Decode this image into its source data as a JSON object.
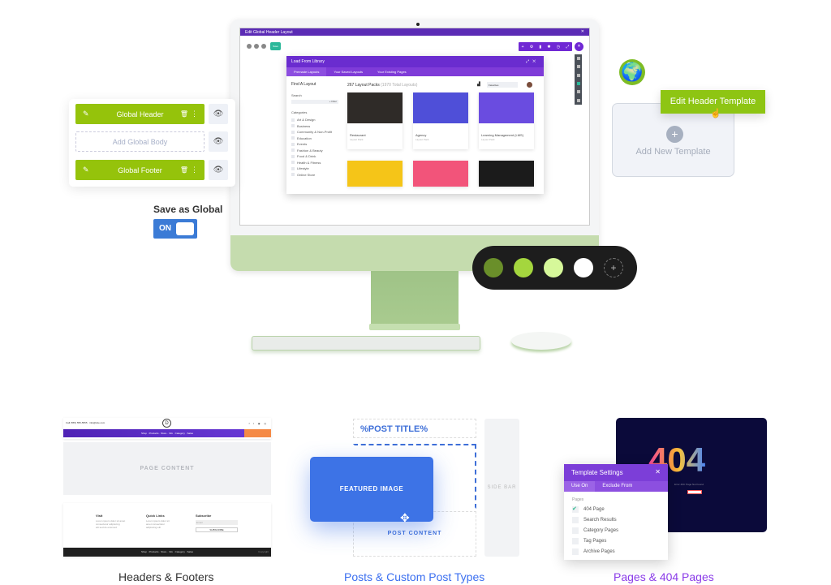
{
  "editor": {
    "window_title": "Edit Global Header Layout",
    "save_label": "Save",
    "library": {
      "title": "Load From Library",
      "tabs": [
        "Premade Layouts",
        "Your Saved Layouts",
        "Your Existing Pages"
      ],
      "find_label": "Find A Layout",
      "search_label": "Search",
      "filter_label": "+ Filter",
      "categories_label": "Categories",
      "categories": [
        "Art & Design",
        "Business",
        "Community & Non-Profit",
        "Education",
        "Events",
        "Fashion & Beauty",
        "Food & Drink",
        "Health & Fitness",
        "Lifestyle",
        "Online Store"
      ],
      "packs_count": "267 Layout Packs",
      "total_layouts": "(1970 Total Layouts)",
      "sort_value": "Favorites",
      "cards": [
        {
          "name": "Restaurant",
          "sub": "Layout Pack",
          "color": "#2f2b28"
        },
        {
          "name": "Agency",
          "sub": "Layout Pack",
          "color": "#4f4fd8"
        },
        {
          "name": "Learning Management (LMS)",
          "sub": "Layout Pack",
          "color": "#6a4ce0"
        }
      ],
      "row2_colors": [
        "#f5c518",
        "#f2547a",
        "#1b1b1b"
      ]
    }
  },
  "global_panel": {
    "header_label": "Global Header",
    "body_label": "Add Global Body",
    "footer_label": "Global Footer",
    "save_as_global_label": "Save as Global",
    "toggle_label": "ON",
    "toggle_state": "on"
  },
  "templates": {
    "edit_header_label": "Edit Header Template",
    "add_new_label": "Add New Template"
  },
  "palette": {
    "swatches": [
      "#6a8f2a",
      "#a4d63e",
      "#d6f89a",
      "#ffffff"
    ],
    "add_label": "+"
  },
  "features": {
    "headers_footers": {
      "caption": "Headers & Footers",
      "page_content_label": "PAGE CONTENT",
      "footer_cols": [
        "Visit",
        "Quick Links",
        "Subscribe"
      ],
      "subscribe_btn": "SUBSCRIBE"
    },
    "posts": {
      "caption": "Posts & Custom Post Types",
      "title_placeholder": "%POST TITLE%",
      "featured_label": "FEATURED IMAGE",
      "content_label": "POST CONTENT",
      "sidebar_label": "SIDE BAR"
    },
    "pages404": {
      "caption": "Pages & 404 Pages",
      "big_text": "404",
      "sub_text": "Error 404: Page Not Found",
      "settings_title": "Template Settings",
      "tabs": [
        "Use On",
        "Exclude From"
      ],
      "pages_label": "Pages",
      "pages": [
        {
          "label": "404 Page",
          "checked": true
        },
        {
          "label": "Search Results",
          "checked": false
        },
        {
          "label": "Category Pages",
          "checked": false
        },
        {
          "label": "Tag Pages",
          "checked": false
        },
        {
          "label": "Archive Pages",
          "checked": false
        }
      ]
    }
  },
  "colors": {
    "accent_green": "#8ec513",
    "divi_purple": "#6a2ccf",
    "blue": "#3e6fd8",
    "caption_posts": "#3b6ff0",
    "caption_pages": "#8a3be8"
  }
}
